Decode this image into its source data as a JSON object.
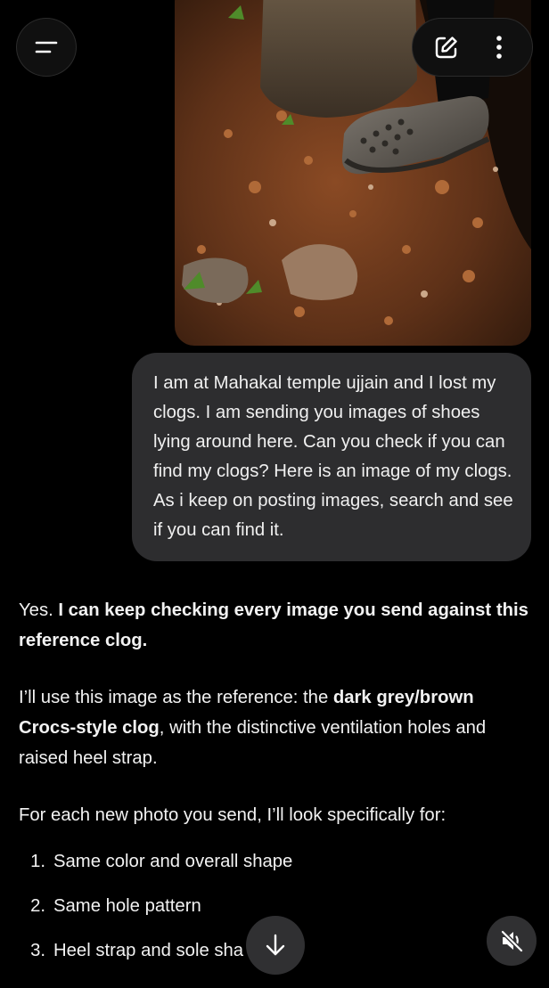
{
  "header": {
    "menu_icon": "menu-icon",
    "edit_icon": "edit-icon",
    "more_icon": "more-vertical-icon"
  },
  "attachment": {
    "description_icon": "photo-of-clog"
  },
  "user_message": {
    "text": "I am at Mahakal temple ujjain and I lost my clogs. I am sending you images of shoes lying around here. Can you check if you can find my clogs? Here is an image of my clogs. As i keep on posting images, search and see if you can find it."
  },
  "assistant": {
    "p1_plain": "Yes. ",
    "p1_bold": "I can keep checking every image you send against this reference clog.",
    "p2_pre": "I’ll use this image as the reference: the ",
    "p2_bold": "dark grey/brown Crocs-style clog",
    "p2_post": ", with the distinctive ventilation holes and raised heel strap.",
    "p3": "For each new photo you send, I’ll look specifically for:",
    "steps": [
      {
        "num": "1.",
        "text": "Same color and overall shape"
      },
      {
        "num": "2.",
        "text": "Same hole pattern"
      },
      {
        "num": "3.",
        "text": "Heel strap and sole sha"
      }
    ]
  },
  "footer": {
    "scroll_icon": "arrow-down-icon",
    "mute_icon": "speaker-muted-icon"
  },
  "colors": {
    "background": "#000000",
    "bubble": "#2d2d2f",
    "text": "#f2f2f2",
    "button": "#101010"
  }
}
